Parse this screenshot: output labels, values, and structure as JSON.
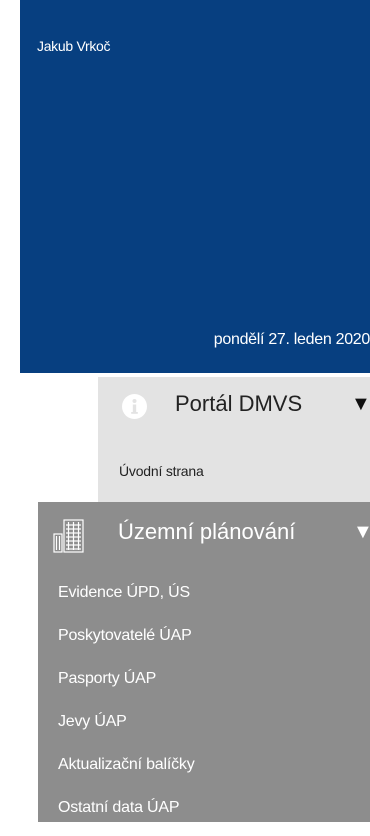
{
  "header": {
    "user_name": "Jakub Vrkoč",
    "date": "pondělí 27. leden 2020",
    "background": "#073f80"
  },
  "portal_section": {
    "icon": "info-icon",
    "title": "Portál DMVS",
    "items": [
      {
        "label": "Úvodní strana"
      }
    ]
  },
  "planning_section": {
    "icon": "building-icon",
    "title": "Územní plánování",
    "items": [
      {
        "label": "Evidence ÚPD, ÚS"
      },
      {
        "label": "Poskytovatelé ÚAP"
      },
      {
        "label": "Pasporty ÚAP"
      },
      {
        "label": "Jevy ÚAP"
      },
      {
        "label": "Aktualizační balíčky"
      },
      {
        "label": "Ostatní data ÚAP"
      }
    ]
  }
}
